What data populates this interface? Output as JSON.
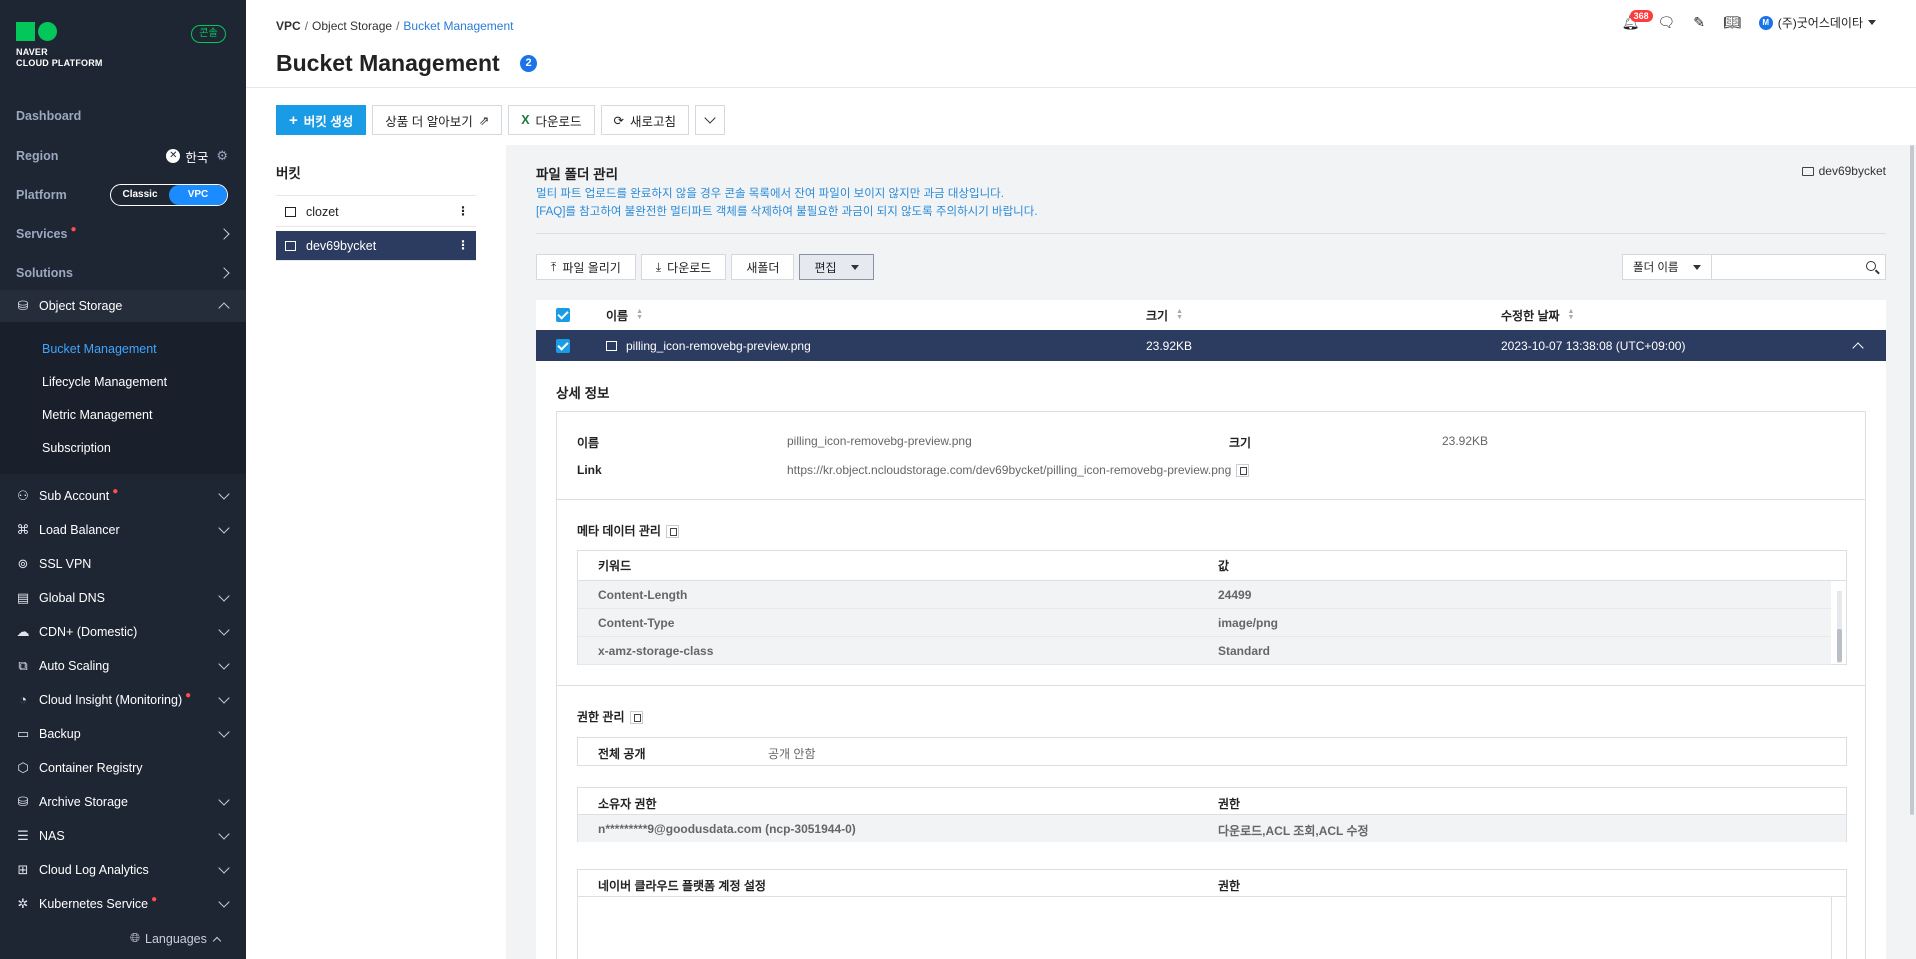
{
  "sidebar": {
    "logo_line1": "NAVER",
    "logo_line2": "CLOUD PLATFORM",
    "console_badge": "콘솔",
    "dashboard": "Dashboard",
    "region_label": "Region",
    "region_value": "한국",
    "platform_label": "Platform",
    "platform_classic": "Classic",
    "platform_vpc": "VPC",
    "services": "Services",
    "solutions": "Solutions",
    "object_storage": "Object Storage",
    "sub_items": [
      "Bucket Management",
      "Lifecycle Management",
      "Metric Management",
      "Subscription"
    ],
    "services_list": [
      {
        "label": "Sub Account",
        "dot": true,
        "icon": "users-icon"
      },
      {
        "label": "Load Balancer",
        "dot": false,
        "icon": "load-balancer-icon"
      },
      {
        "label": "SSL VPN",
        "dot": false,
        "icon": "vpn-icon"
      },
      {
        "label": "Global DNS",
        "dot": false,
        "icon": "dns-icon"
      },
      {
        "label": "CDN+ (Domestic)",
        "dot": false,
        "icon": "cdn-icon"
      },
      {
        "label": "Auto Scaling",
        "dot": false,
        "icon": "scaling-icon"
      },
      {
        "label": "Cloud Insight (Monitoring)",
        "dot": true,
        "icon": "monitoring-icon"
      },
      {
        "label": "Backup",
        "dot": false,
        "icon": "backup-icon"
      },
      {
        "label": "Container Registry",
        "dot": false,
        "icon": "registry-icon"
      },
      {
        "label": "Archive Storage",
        "dot": false,
        "icon": "archive-icon"
      },
      {
        "label": "NAS",
        "dot": false,
        "icon": "nas-icon"
      },
      {
        "label": "Cloud Log Analytics",
        "dot": false,
        "icon": "log-icon"
      },
      {
        "label": "Kubernetes Service",
        "dot": true,
        "icon": "kubernetes-icon"
      }
    ],
    "languages": "Languages"
  },
  "header": {
    "breadcrumb": [
      "VPC",
      "Object Storage",
      "Bucket Management"
    ],
    "title": "Bucket Management",
    "help_badge": "2",
    "notification_count": "368",
    "user_initial": "M",
    "user_name": "(주)굿어스데이타"
  },
  "toolbar": {
    "create": "버킷 생성",
    "learn_more": "상품 더 알아보기",
    "download": "다운로드",
    "refresh": "새로고침"
  },
  "buckets": {
    "title": "버킷",
    "items": [
      "clozet",
      "dev69bycket"
    ]
  },
  "files": {
    "title": "파일 폴더 관리",
    "note1": "멀티 파트 업로드를 완료하지 않을 경우 콘솔 목록에서 잔여 파일이 보이지 않지만 과금 대상입니다.",
    "note2": "[FAQ]를 참고하여 불완전한 멀티파트 객체를 삭제하여 불필요한 과금이 되지 않도록 주의하시기 바랍니다.",
    "current_folder": "dev69bycket",
    "upload": "파일 올리기",
    "download": "다운로드",
    "new_folder": "새폴더",
    "edit": "편집",
    "search_select": "폴더 이름",
    "search_placeholder": "",
    "columns": [
      "이름",
      "크기",
      "수정한 날짜"
    ],
    "row": {
      "name": "pilling_icon-removebg-preview.png",
      "size": "23.92KB",
      "modified": "2023-10-07 13:38:08 (UTC+09:00)"
    }
  },
  "detail": {
    "title": "상세 정보",
    "name_label": "이름",
    "name_value": "pilling_icon-removebg-preview.png",
    "size_label": "크기",
    "size_value": "23.92KB",
    "link_label": "Link",
    "link_value": "https://kr.object.ncloudstorage.com/dev69bycket/pilling_icon-removebg-preview.png",
    "meta_title": "메타 데이터 관리",
    "meta_columns": [
      "키워드",
      "값"
    ],
    "meta_rows": [
      {
        "k": "Content-Length",
        "v": "24499"
      },
      {
        "k": "Content-Type",
        "v": "image/png"
      },
      {
        "k": "x-amz-storage-class",
        "v": "Standard"
      }
    ],
    "perm_title": "권한 관리",
    "public_label": "전체 공개",
    "public_value": "공개 안함",
    "owner_col": "소유자 권한",
    "perm_col": "권한",
    "owner_value": "n*********9@goodusdata.com (ncp-3051944-0)",
    "owner_perm": "다운로드,ACL 조회,ACL 수정",
    "ncp_col": "네이버 클라우드 플랫폼 계정 설정",
    "ncp_perm_col": "권한"
  },
  "colors": {
    "sidebar_bg": "#1f2633",
    "accent": "#1a9be6",
    "selected_row": "#2c3b60",
    "brand_green": "#03c75a"
  }
}
